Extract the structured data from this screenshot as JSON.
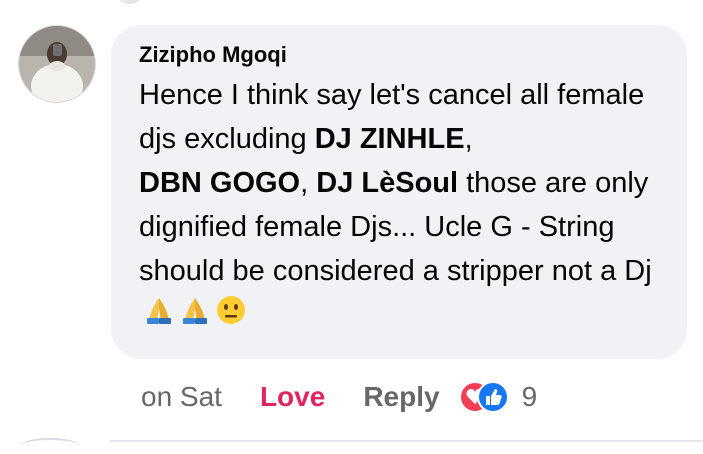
{
  "comment": {
    "author": "Zizipho Mgoqi",
    "text_parts": [
      {
        "text": "Hence I think say let's cancel all female djs excluding ",
        "bold": false
      },
      {
        "text": "DJ ZINHLE",
        "bold": true
      },
      {
        "text": ", ",
        "bold": false
      },
      {
        "text": "DBN GOGO",
        "bold": true
      },
      {
        "text": ", ",
        "bold": false
      },
      {
        "text": "DJ LèSoul",
        "bold": true
      },
      {
        "text": " those are only dignified female Djs... Ucle G - String should be considered a stripper not a Dj",
        "bold": false
      }
    ],
    "emojis": [
      "folded-hands-icon",
      "folded-hands-icon",
      "neutral-face-icon"
    ]
  },
  "actions": {
    "time": "on Sat",
    "love": "Love",
    "reply": "Reply",
    "reaction_count": "9"
  },
  "colors": {
    "bubble": "#f0f2f5",
    "love": "#e0245e",
    "muted": "#65676b",
    "like_blue": "#1877f2",
    "love_red": "#f33e58"
  }
}
